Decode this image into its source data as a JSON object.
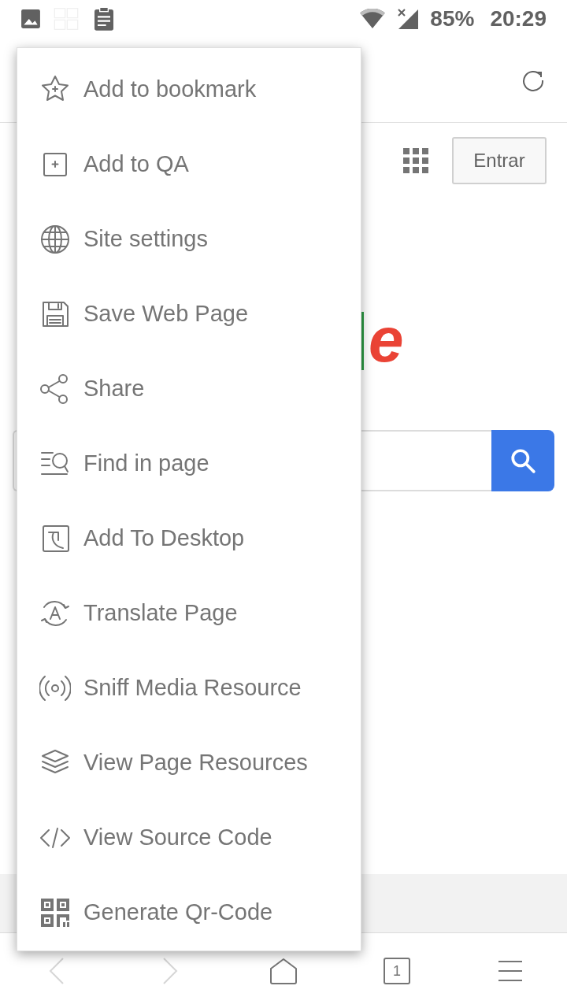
{
  "status_bar": {
    "battery": "85%",
    "time": "20:29"
  },
  "page": {
    "signin_button": "Entrar",
    "logo_letter": {
      "text": "e",
      "color": "#ea4335"
    }
  },
  "menu": {
    "items": [
      {
        "label": "Add to bookmark"
      },
      {
        "label": "Add to QA"
      },
      {
        "label": "Site settings"
      },
      {
        "label": "Save Web Page"
      },
      {
        "label": "Share"
      },
      {
        "label": "Find in page"
      },
      {
        "label": "Add To Desktop"
      },
      {
        "label": "Translate Page"
      },
      {
        "label": "Sniff Media Resource"
      },
      {
        "label": "View Page Resources"
      },
      {
        "label": "View Source Code"
      },
      {
        "label": "Generate Qr-Code"
      }
    ]
  },
  "bottom_bar": {
    "back": {
      "disabled": true
    },
    "forward": {
      "disabled": true
    },
    "tab_count": "1"
  }
}
